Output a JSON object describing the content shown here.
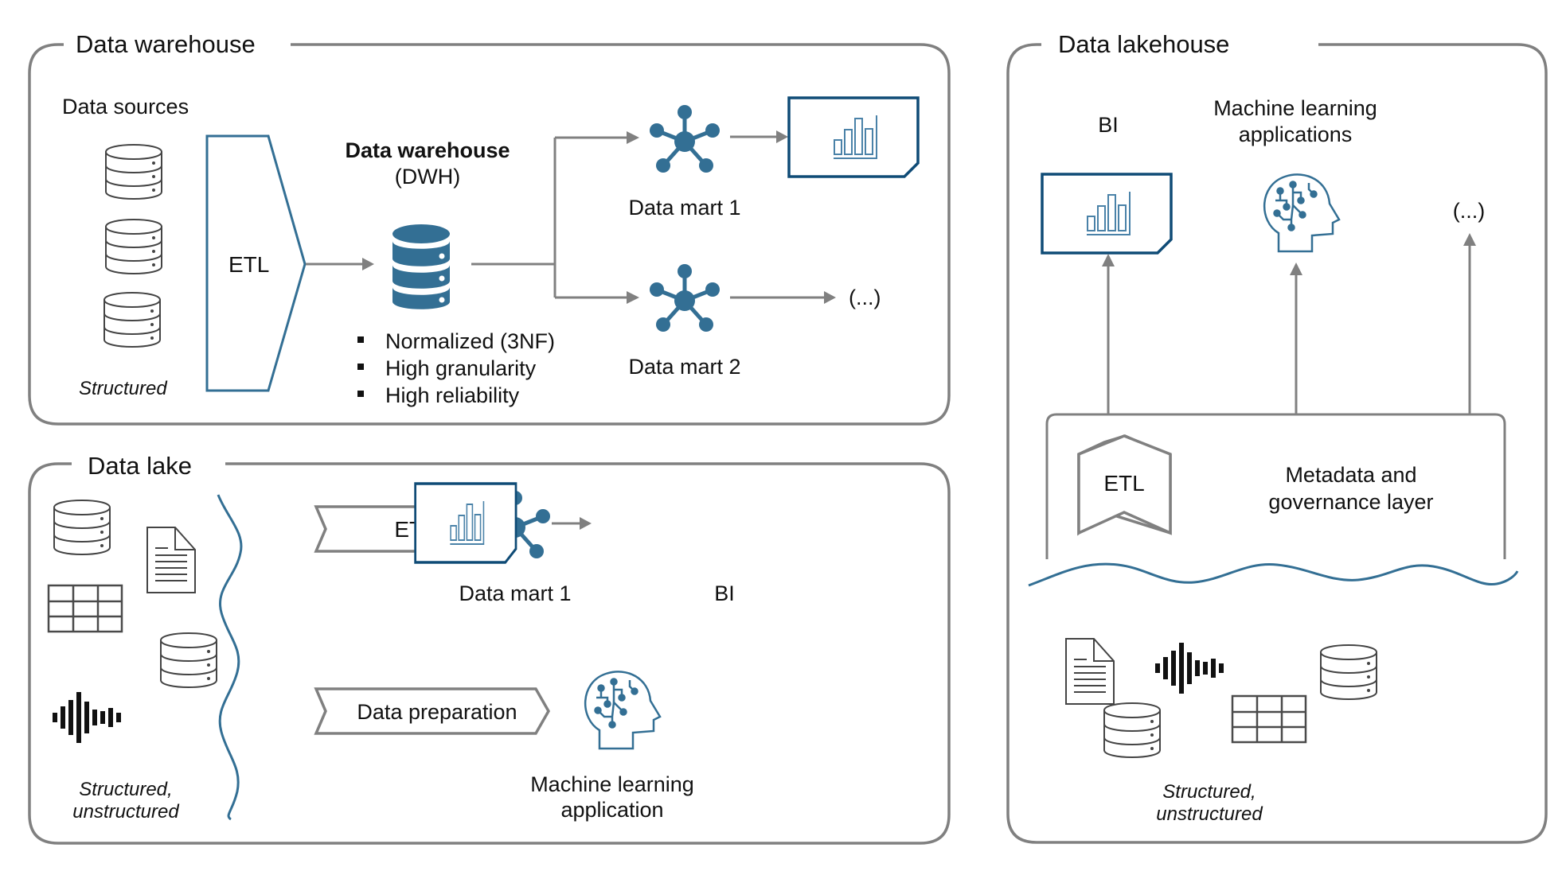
{
  "warehouse": {
    "title": "Data warehouse",
    "data_sources_label": "Data sources",
    "sources_caption": "Structured",
    "etl_label": "ETL",
    "dwh_title": "Data warehouse",
    "dwh_subtitle": "(DWH)",
    "properties": [
      "Normalized (3NF)",
      "High granularity",
      "High reliability"
    ],
    "data_mart_1": "Data mart 1",
    "data_mart_2": "Data mart 2",
    "ellipsis": "(...)"
  },
  "lake": {
    "title": "Data lake",
    "sources_caption": [
      "Structured,",
      "unstructured"
    ],
    "etl_label": "ETL",
    "data_prep_label": "Data preparation",
    "data_mart_1": "Data mart 1",
    "bi_label": "BI",
    "ml_label": [
      "Machine learning",
      "application"
    ]
  },
  "lakehouse": {
    "title": "Data lakehouse",
    "bi_label": "BI",
    "ml_label": [
      "Machine learning",
      "applications"
    ],
    "ellipsis": "(...)",
    "etl_label": "ETL",
    "layer_label": [
      "Metadata and",
      "governance layer"
    ],
    "sources_caption": [
      "Structured,",
      "unstructured"
    ]
  },
  "colors": {
    "accent_blue": "#336f94",
    "bi_border": "#0f4b76",
    "frame_gray": "#808080"
  }
}
